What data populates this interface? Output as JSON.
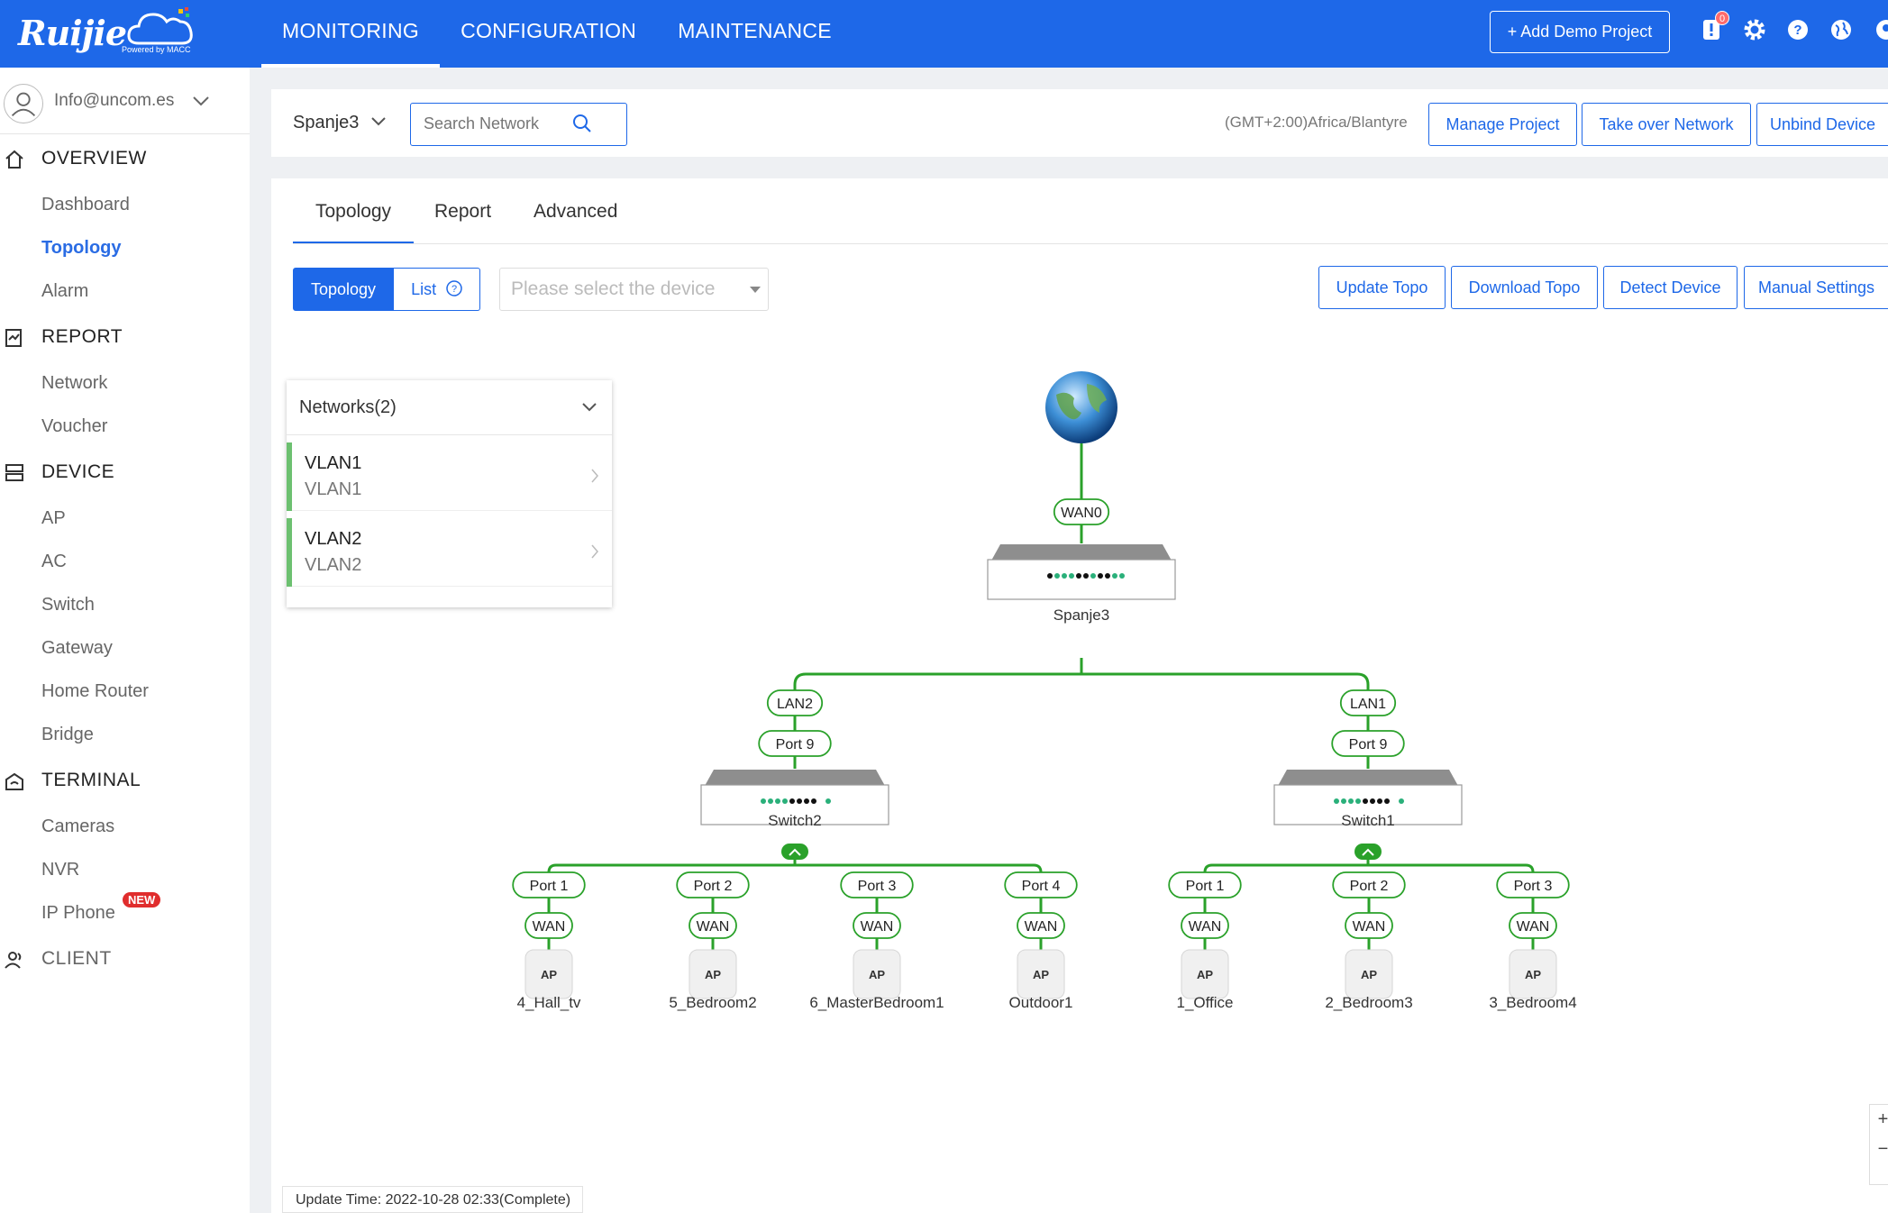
{
  "brand": {
    "logo_text": "Ruijie",
    "powered_by": "Powered by MACC"
  },
  "topnav": {
    "items": [
      "MONITORING",
      "CONFIGURATION",
      "MAINTENANCE"
    ],
    "active": "MONITORING"
  },
  "header": {
    "add_demo_label": "+ Add Demo Project",
    "alerts_count": "0"
  },
  "sidebar": {
    "email": "Info@uncom.es",
    "sections": [
      {
        "title": "OVERVIEW",
        "items": [
          "Dashboard",
          "Topology",
          "Alarm"
        ]
      },
      {
        "title": "REPORT",
        "items": [
          "Network",
          "Voucher"
        ]
      },
      {
        "title": "DEVICE",
        "items": [
          "AP",
          "AC",
          "Switch",
          "Gateway",
          "Home Router",
          "Bridge"
        ]
      },
      {
        "title": "TERMINAL",
        "items": [
          "Cameras",
          "NVR",
          "IP Phone"
        ]
      },
      {
        "title": "CLIENT",
        "items": []
      }
    ],
    "active_item": "Topology",
    "new_badge": "NEW"
  },
  "project": {
    "name": "Spanje3",
    "search_placeholder": "Search Network",
    "timezone": "(GMT+2:00)Africa/Blantyre",
    "buttons": [
      "Manage Project",
      "Take over Network",
      "Unbind Device"
    ]
  },
  "tabs": [
    "Topology",
    "Report",
    "Advanced"
  ],
  "view_toggle": {
    "topology": "Topology",
    "list": "List"
  },
  "device_select": {
    "placeholder": "Please select the device"
  },
  "actions": [
    "Update Topo",
    "Download Topo",
    "Detect Device",
    "Manual Settings"
  ],
  "networks": {
    "title": "Networks(2)",
    "items": [
      {
        "name": "VLAN1",
        "sub": "VLAN1"
      },
      {
        "name": "VLAN2",
        "sub": "VLAN2"
      }
    ]
  },
  "topology": {
    "gateway": {
      "name": "Spanje3",
      "uplink": "WAN0"
    },
    "switches": [
      {
        "name": "Switch2",
        "link": "LAN2",
        "port": "Port 9",
        "aps": [
          {
            "port": "Port 1",
            "wan": "WAN",
            "name": "4_Hall_tv"
          },
          {
            "port": "Port 2",
            "wan": "WAN",
            "name": "5_Bedroom2"
          },
          {
            "port": "Port 3",
            "wan": "WAN",
            "name": "6_MasterBedroom1"
          },
          {
            "port": "Port 4",
            "wan": "WAN",
            "name": "Outdoor1"
          }
        ]
      },
      {
        "name": "Switch1",
        "link": "LAN1",
        "port": "Port 9",
        "aps": [
          {
            "port": "Port 1",
            "wan": "WAN",
            "name": "1_Office"
          },
          {
            "port": "Port 2",
            "wan": "WAN",
            "name": "2_Bedroom3"
          },
          {
            "port": "Port 3",
            "wan": "WAN",
            "name": "3_Bedroom4"
          }
        ]
      }
    ],
    "ap_label": "AP",
    "update_time": "Update Time: 2022-10-28 02:33(Complete)"
  },
  "zoom": {
    "in": "+",
    "out": "−"
  },
  "colors": {
    "brand": "#1e68e8",
    "link": "#2aa12a",
    "vlan_bar": "#6cc070",
    "badge": "#e02d2d"
  }
}
